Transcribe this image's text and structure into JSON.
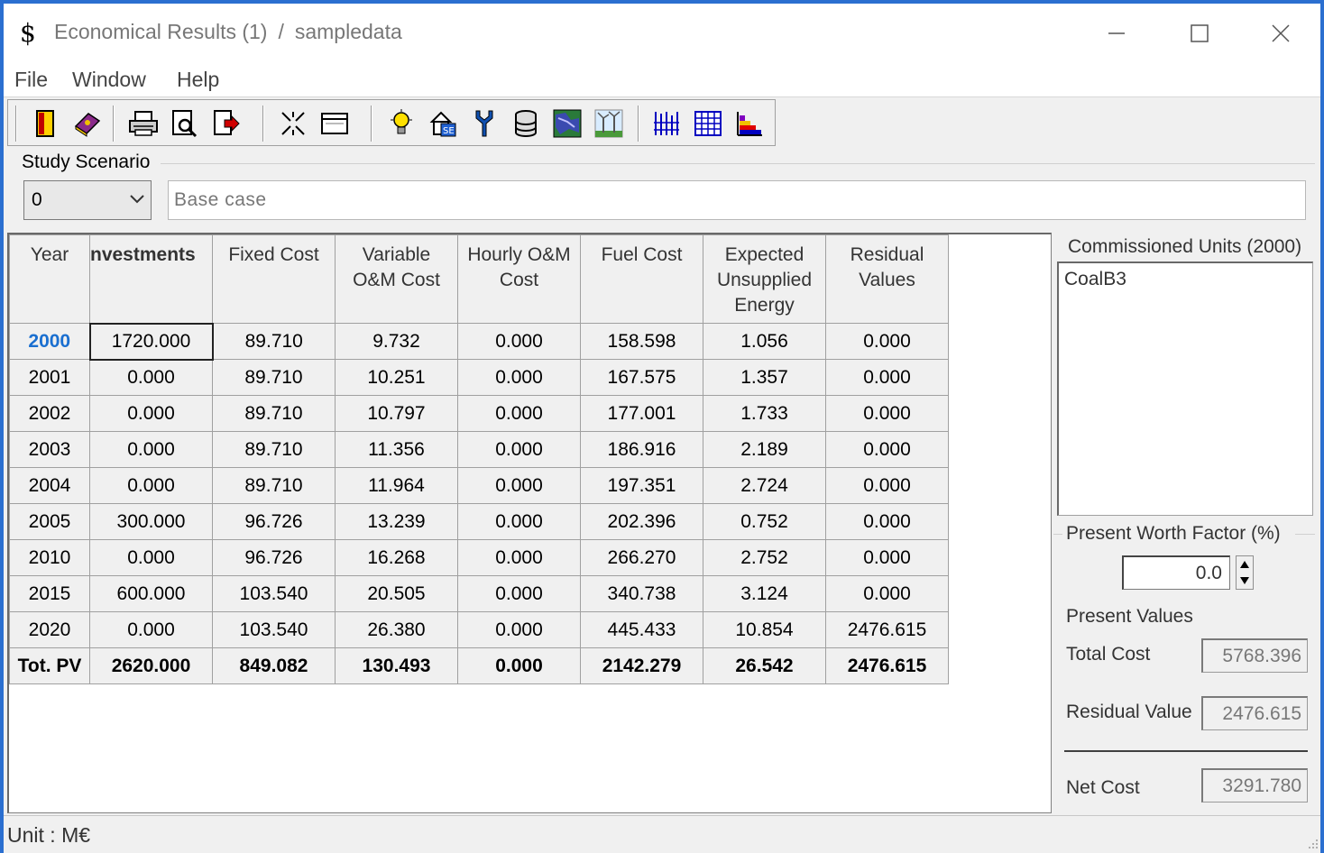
{
  "window": {
    "title_app": "Economical Results (1)",
    "title_separator": "/",
    "title_file": "sampledata",
    "app_icon_glyph": "$"
  },
  "menu": {
    "file": "File",
    "window": "Window",
    "help": "Help"
  },
  "toolbar": {
    "icons": [
      "exit-door-icon",
      "book-icon",
      "print-icon",
      "print-preview-icon",
      "export-icon",
      "collapse-icon",
      "window-icon",
      "lightbulb-icon",
      "house-se-icon",
      "connector-icon",
      "database-icon",
      "map-icon",
      "wind-farm-icon",
      "bar-chart-icon",
      "table-grid-icon",
      "stacked-chart-icon"
    ]
  },
  "scenario": {
    "label": "Study Scenario",
    "selected": "0",
    "description": "Base case"
  },
  "table": {
    "headers": {
      "year": "Year",
      "investments": "nvestments",
      "fixed": [
        "Fixed Cost"
      ],
      "variable": [
        "Variable",
        "O&M Cost"
      ],
      "hourly": [
        "Hourly O&M",
        "Cost"
      ],
      "fuel": [
        "Fuel Cost"
      ],
      "expected": [
        "Expected",
        "Unsupplied",
        "Energy"
      ],
      "residual": [
        "Residual",
        "Values"
      ]
    },
    "rows": [
      {
        "year": "2000",
        "investments": "1720.000",
        "fixed": "89.710",
        "variable": "9.732",
        "hourly": "0.000",
        "fuel": "158.598",
        "expected": "1.056",
        "residual": "0.000"
      },
      {
        "year": "2001",
        "investments": "0.000",
        "fixed": "89.710",
        "variable": "10.251",
        "hourly": "0.000",
        "fuel": "167.575",
        "expected": "1.357",
        "residual": "0.000"
      },
      {
        "year": "2002",
        "investments": "0.000",
        "fixed": "89.710",
        "variable": "10.797",
        "hourly": "0.000",
        "fuel": "177.001",
        "expected": "1.733",
        "residual": "0.000"
      },
      {
        "year": "2003",
        "investments": "0.000",
        "fixed": "89.710",
        "variable": "11.356",
        "hourly": "0.000",
        "fuel": "186.916",
        "expected": "2.189",
        "residual": "0.000"
      },
      {
        "year": "2004",
        "investments": "0.000",
        "fixed": "89.710",
        "variable": "11.964",
        "hourly": "0.000",
        "fuel": "197.351",
        "expected": "2.724",
        "residual": "0.000"
      },
      {
        "year": "2005",
        "investments": "300.000",
        "fixed": "96.726",
        "variable": "13.239",
        "hourly": "0.000",
        "fuel": "202.396",
        "expected": "0.752",
        "residual": "0.000"
      },
      {
        "year": "2010",
        "investments": "0.000",
        "fixed": "96.726",
        "variable": "16.268",
        "hourly": "0.000",
        "fuel": "266.270",
        "expected": "2.752",
        "residual": "0.000"
      },
      {
        "year": "2015",
        "investments": "600.000",
        "fixed": "103.540",
        "variable": "20.505",
        "hourly": "0.000",
        "fuel": "340.738",
        "expected": "3.124",
        "residual": "0.000"
      },
      {
        "year": "2020",
        "investments": "0.000",
        "fixed": "103.540",
        "variable": "26.380",
        "hourly": "0.000",
        "fuel": "445.433",
        "expected": "10.854",
        "residual": "2476.615"
      }
    ],
    "total": {
      "year": "Tot. PV",
      "investments": "2620.000",
      "fixed": "849.082",
      "variable": "130.493",
      "hourly": "0.000",
      "fuel": "2142.279",
      "expected": "26.542",
      "residual": "2476.615"
    }
  },
  "commissioned": {
    "title": "Commissioned Units (2000)",
    "units": [
      "CoalB3"
    ]
  },
  "present_worth": {
    "title": "Present Worth Factor (%)",
    "value": "0.0"
  },
  "present_values": {
    "title": "Present Values",
    "total_cost_label": "Total Cost",
    "total_cost": "5768.396",
    "residual_value_label": "Residual Value",
    "residual_value": "2476.615",
    "net_cost_label": "Net Cost",
    "net_cost": "3291.780"
  },
  "status": {
    "unit": "Unit : M€"
  },
  "colors": {
    "accent_blue": "#1a6fd0",
    "window_border": "#2b6fd0"
  }
}
